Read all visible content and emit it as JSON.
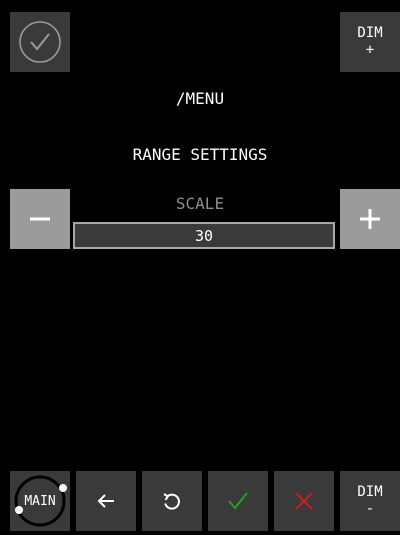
{
  "header": {
    "dim_up_label": "DIM",
    "dim_up_sign": "+"
  },
  "menu": {
    "path": "/MENU",
    "section_title": "RANGE SETTINGS"
  },
  "scale": {
    "label": "SCALE",
    "value": "30"
  },
  "footer": {
    "main_label": "MAIN",
    "dim_down_label": "DIM",
    "dim_down_sign": "-"
  },
  "icons": {
    "top_left": "check-circle-icon",
    "minus": "minus-icon",
    "plus": "plus-icon",
    "back": "arrow-left-icon",
    "undo": "undo-icon",
    "confirm": "check-icon",
    "cancel": "x-icon"
  },
  "colors": {
    "background": "#000000",
    "button": "#3a3a3a",
    "stepper_button": "#9b9b9b",
    "confirm": "#1fa31f",
    "cancel": "#c21f1f",
    "muted_text": "#8c8c8c"
  }
}
